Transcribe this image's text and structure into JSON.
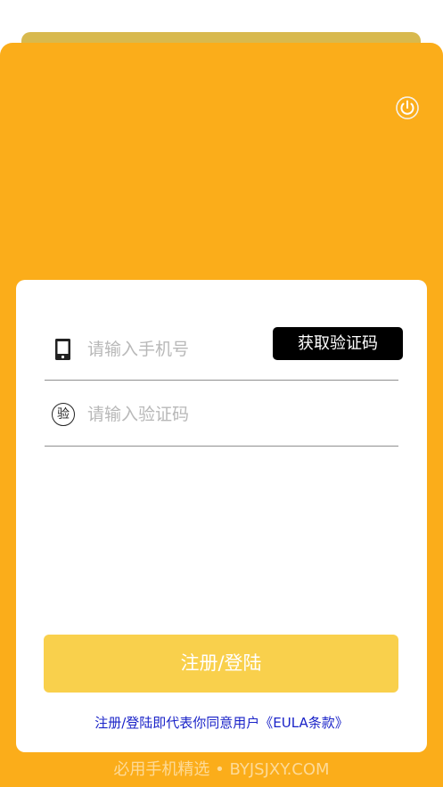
{
  "header": {
    "power_icon": "power-icon"
  },
  "login": {
    "phone_placeholder": "请输入手机号",
    "code_placeholder": "请输入验证码",
    "code_badge": "验",
    "get_code_label": "获取验证码",
    "submit_label": "注册/登陆",
    "agreement_text": "注册/登陆即代表你同意用户《EULA条款》"
  },
  "footer": {
    "watermark": "必用手机精选 • BYJSJXY.COM"
  },
  "colors": {
    "primary": "#fbad1a",
    "button": "#f9d04c",
    "card": "#ffffff",
    "link": "#1a23c8"
  }
}
